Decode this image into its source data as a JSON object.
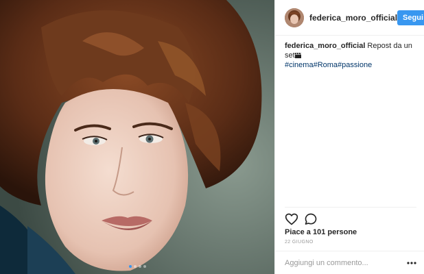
{
  "post": {
    "username": "federica_moro_official",
    "follow_label": "Segui",
    "caption": {
      "username": "federica_moro_official",
      "text": " Repost da un set",
      "emoji_icon": "clapperboard-icon",
      "hashtags": [
        "#cinema",
        "#Roma",
        "#passione"
      ]
    },
    "likes": "Piace a 101 persone",
    "timestamp": "22 GIUGNO",
    "comment_placeholder": "Aggiungi un commento...",
    "carousel": {
      "slides": 4,
      "active_index": 0
    },
    "icons": {
      "like": "heart-icon",
      "comment": "comment-bubble-icon",
      "more": "more-options-icon"
    },
    "colors": {
      "accent": "#3897f0",
      "hashtag": "#003569",
      "muted": "#999999",
      "border": "#efefef"
    }
  }
}
